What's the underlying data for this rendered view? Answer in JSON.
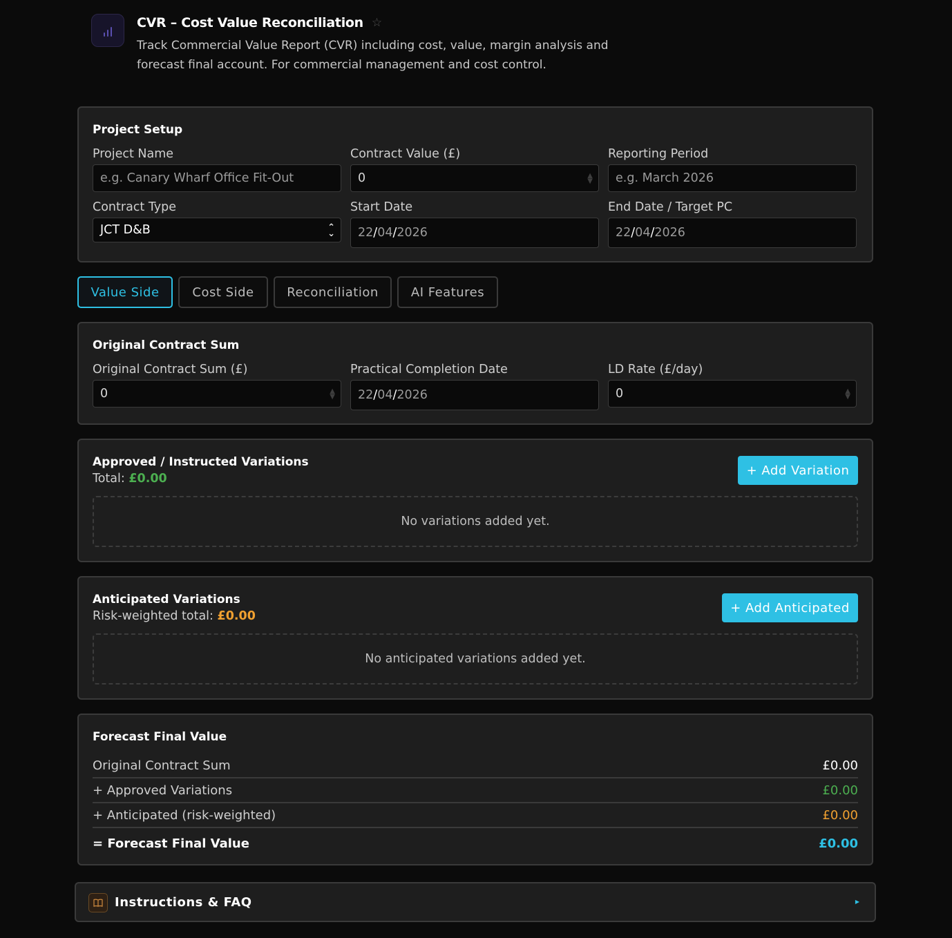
{
  "header": {
    "title": "CVR – Cost Value Reconciliation",
    "description": "Track Commercial Value Report (CVR) including cost, value, margin analysis and forecast final account. For commercial management and cost control.",
    "app_icon": "bar-chart-icon",
    "favorite_icon": "star-icon"
  },
  "project_setup": {
    "title": "Project Setup",
    "project_name": {
      "label": "Project Name",
      "placeholder": "e.g. Canary Wharf Office Fit-Out",
      "value": ""
    },
    "contract_value": {
      "label": "Contract Value (£)",
      "value": "0"
    },
    "reporting_period": {
      "label": "Reporting Period",
      "placeholder": "e.g. March 2026",
      "value": ""
    },
    "contract_type": {
      "label": "Contract Type",
      "value": "JCT D&B"
    },
    "start_date": {
      "label": "Start Date",
      "day": "22",
      "month": "04",
      "year": "2026",
      "sep": "/"
    },
    "end_date": {
      "label": "End Date / Target PC",
      "day": "22",
      "month": "04",
      "year": "2026",
      "sep": "/"
    }
  },
  "tabs": [
    {
      "label": "Value Side",
      "active": true
    },
    {
      "label": "Cost Side",
      "active": false
    },
    {
      "label": "Reconciliation",
      "active": false
    },
    {
      "label": "AI Features",
      "active": false
    }
  ],
  "original_contract": {
    "title": "Original Contract Sum",
    "sum": {
      "label": "Original Contract Sum (£)",
      "value": "0"
    },
    "pc_date": {
      "label": "Practical Completion Date",
      "day": "22",
      "month": "04",
      "year": "2026",
      "sep": "/"
    },
    "ld_rate": {
      "label": "LD Rate (£/day)",
      "value": "0"
    }
  },
  "approved_variations": {
    "title": "Approved / Instructed Variations",
    "total_label": "Total:",
    "total_value": "£0.00",
    "add_button": "+ Add Variation",
    "empty_text": "No variations added yet."
  },
  "anticipated_variations": {
    "title": "Anticipated Variations",
    "total_label": "Risk-weighted total:",
    "total_value": "£0.00",
    "add_button": "+ Add Anticipated",
    "empty_text": "No anticipated variations added yet."
  },
  "forecast": {
    "title": "Forecast Final Value",
    "rows": [
      {
        "label": "Original Contract Sum",
        "value": "£0.00"
      },
      {
        "label": "+ Approved Variations",
        "value": "£0.00"
      },
      {
        "label": "+ Anticipated (risk-weighted)",
        "value": "£0.00"
      },
      {
        "label": "= Forecast Final Value",
        "value": "£0.00"
      }
    ]
  },
  "faq": {
    "title": "Instructions & FAQ",
    "icon": "book-icon",
    "caret_icon": "caret-right-icon"
  },
  "colors": {
    "accent": "#2ec0e4",
    "positive": "#4caf50",
    "warning": "#f0a030",
    "background": "#0b0b0b",
    "card": "#1e1e1e"
  }
}
